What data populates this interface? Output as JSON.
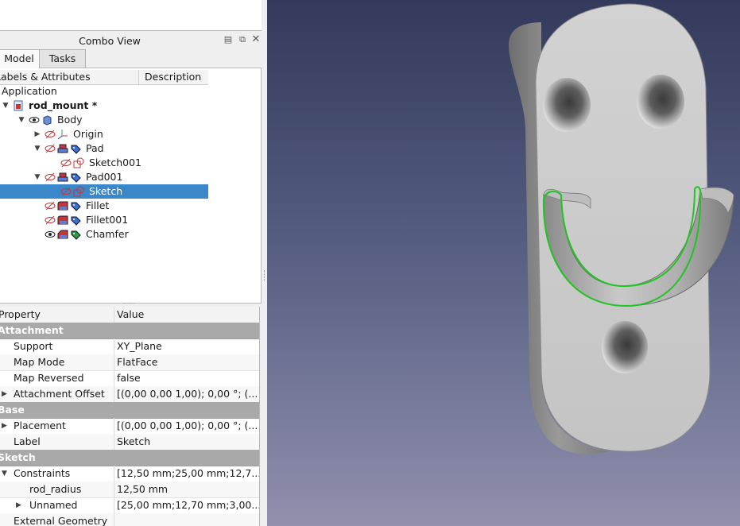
{
  "combo_view": {
    "title": "Combo View",
    "tabs": [
      "Model",
      "Tasks"
    ],
    "active_tab": "Model"
  },
  "tree": {
    "headers": [
      "Labels & Attributes",
      "Description"
    ],
    "rows": [
      {
        "label": "Application",
        "indent": 0,
        "arrow": "",
        "icons": []
      },
      {
        "label": "rod_mount *",
        "indent": 1,
        "arrow": "down",
        "icons": [
          "document-icon"
        ],
        "bold": true
      },
      {
        "label": "Body",
        "indent": 2,
        "arrow": "down",
        "icons": [
          "eye-icon",
          "body-icon"
        ]
      },
      {
        "label": "Origin",
        "indent": 3,
        "arrow": "right",
        "icons": [
          "hidden-eye-icon",
          "axes-icon"
        ]
      },
      {
        "label": "Pad",
        "indent": 3,
        "arrow": "down",
        "icons": [
          "hidden-eye-icon",
          "pad-icon",
          "tag-icon"
        ]
      },
      {
        "label": "Sketch001",
        "indent": 4,
        "arrow": "",
        "icons": [
          "hidden-eye-icon",
          "sketch-icon"
        ]
      },
      {
        "label": "Pad001",
        "indent": 3,
        "arrow": "down",
        "icons": [
          "hidden-eye-icon",
          "pad-icon",
          "tag-icon"
        ]
      },
      {
        "label": "Sketch",
        "indent": 4,
        "arrow": "",
        "icons": [
          "hidden-eye-icon",
          "sketch-icon"
        ],
        "selected": true
      },
      {
        "label": "Fillet",
        "indent": 3,
        "arrow": "",
        "icons": [
          "hidden-eye-icon",
          "fillet-icon",
          "tag-icon"
        ]
      },
      {
        "label": "Fillet001",
        "indent": 3,
        "arrow": "",
        "icons": [
          "hidden-eye-icon",
          "fillet-icon",
          "tag-icon"
        ]
      },
      {
        "label": "Chamfer",
        "indent": 3,
        "arrow": "",
        "icons": [
          "eye-icon",
          "chamfer-icon",
          "tip-icon"
        ]
      }
    ]
  },
  "properties": {
    "headers": [
      "Property",
      "Value"
    ],
    "rows": [
      {
        "type": "group",
        "name": "Attachment"
      },
      {
        "type": "prop",
        "name": "Support",
        "value": "XY_Plane",
        "indent": 1
      },
      {
        "type": "prop",
        "name": "Map Mode",
        "value": "FlatFace",
        "indent": 1
      },
      {
        "type": "prop",
        "name": "Map Reversed",
        "value": "false",
        "indent": 1
      },
      {
        "type": "prop",
        "name": "Attachment Offset",
        "value": "[(0,00 0,00 1,00); 0,00 °; (...",
        "indent": 1,
        "arrow": "right"
      },
      {
        "type": "group",
        "name": "Base"
      },
      {
        "type": "prop",
        "name": "Placement",
        "value": "[(0,00 0,00 1,00); 0,00 °; (...",
        "indent": 1,
        "arrow": "right"
      },
      {
        "type": "prop",
        "name": "Label",
        "value": "Sketch",
        "indent": 1
      },
      {
        "type": "group",
        "name": "Sketch"
      },
      {
        "type": "prop",
        "name": "Constraints",
        "value": "[12,50 mm;25,00 mm;12,7...",
        "indent": 1,
        "arrow": "down"
      },
      {
        "type": "prop",
        "name": "rod_radius",
        "value": "12,50 mm",
        "indent": 2
      },
      {
        "type": "prop",
        "name": "Unnamed",
        "value": "[25,00 mm;12,70 mm;3,00...",
        "indent": 2,
        "arrow": "right"
      },
      {
        "type": "prop",
        "name": "External Geometry",
        "value": "",
        "indent": 0
      }
    ]
  },
  "viewport": {
    "part_color": "#c8c8c8",
    "highlight_color": "#22c422"
  }
}
